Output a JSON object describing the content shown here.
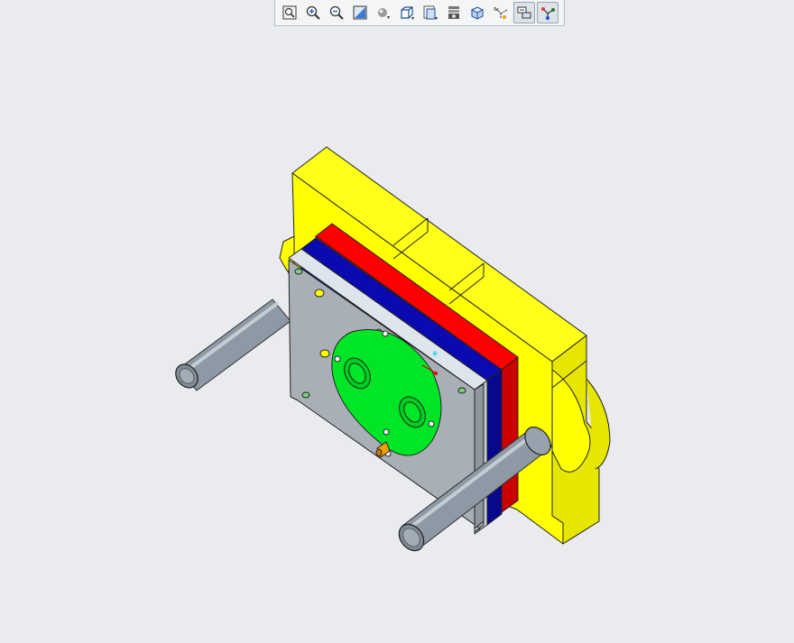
{
  "app": {
    "background_color": "#e9ebef"
  },
  "toolbar": {
    "buttons": [
      {
        "icon": "zoom-fit-icon",
        "active": false
      },
      {
        "icon": "zoom-in-icon",
        "active": false
      },
      {
        "icon": "zoom-out-icon",
        "active": false
      },
      {
        "icon": "repaint-icon",
        "active": false
      },
      {
        "icon": "shading-icon",
        "active": false
      },
      {
        "icon": "display-style-icon",
        "active": false
      },
      {
        "icon": "saved-views-icon",
        "active": false
      },
      {
        "icon": "layers-icon",
        "active": false
      },
      {
        "icon": "section-view-icon",
        "active": false
      },
      {
        "icon": "datum-display-icon",
        "active": false
      },
      {
        "icon": "annotation-display-icon",
        "active": true
      },
      {
        "icon": "spin-center-icon",
        "active": true
      }
    ]
  },
  "model": {
    "colors": {
      "plate_yellow": "#ffff00",
      "plate_red": "#e60000",
      "plate_blue": "#0a0aa8",
      "plate_white": "#d6dde6",
      "plate_gray": "#a9afb6",
      "insert_green": "#00e626",
      "pin_gray": "#8c97a3"
    }
  }
}
